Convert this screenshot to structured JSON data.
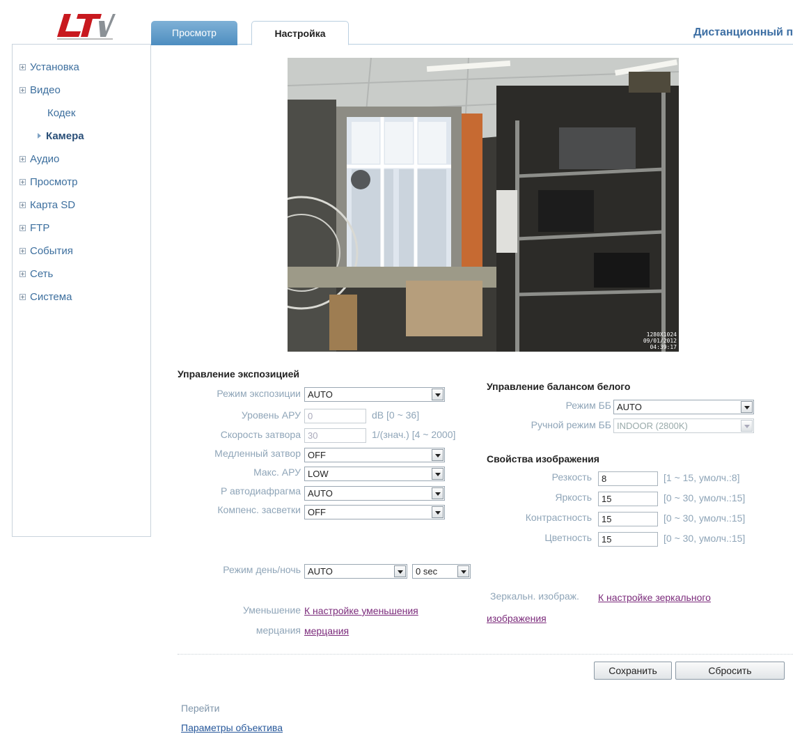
{
  "header": {
    "logo_text": "LTV",
    "tabs": [
      {
        "label": "Просмотр",
        "active": false
      },
      {
        "label": "Настройка",
        "active": true
      }
    ],
    "remote_title": "Дистанционный п"
  },
  "sidebar": {
    "items": [
      {
        "label": "Установка"
      },
      {
        "label": "Видео"
      },
      {
        "label": "Кодек"
      },
      {
        "label": "Камера"
      },
      {
        "label": "Аудио"
      },
      {
        "label": "Просмотр"
      },
      {
        "label": "Карта SD"
      },
      {
        "label": "FTP"
      },
      {
        "label": "События"
      },
      {
        "label": "Сеть"
      },
      {
        "label": "Система"
      }
    ]
  },
  "preview": {
    "osd_resolution": "1280X1024",
    "osd_date": "09/01/2012",
    "osd_time": "04:39:17"
  },
  "exposure": {
    "title": "Управление экспозицией",
    "mode": {
      "label": "Режим экспозиции",
      "value": "AUTO"
    },
    "agc_level": {
      "label": "Уровень АРУ",
      "value": "0",
      "hint": "dB [0 ~ 36]"
    },
    "shutter": {
      "label": "Скорость затвора",
      "value": "30",
      "hint": "1/(знач.) [4 ~ 2000]"
    },
    "slow_shutter": {
      "label": "Медленный затвор",
      "value": "OFF"
    },
    "max_agc": {
      "label": "Макс. АРУ",
      "value": "LOW"
    },
    "p_iris": {
      "label": "P автодиафрагма",
      "value": "AUTO"
    },
    "blc": {
      "label": "Компенс. засветки",
      "value": "OFF"
    }
  },
  "white_balance": {
    "title": "Управление балансом белого",
    "mode": {
      "label": "Режим ББ",
      "value": "AUTO"
    },
    "manual": {
      "label": "Ручной режим ББ",
      "value": "INDOOR (2800K)"
    }
  },
  "image_props": {
    "title": "Свойства изображения",
    "sharpness": {
      "label": "Резкость",
      "value": "8",
      "hint": "[1 ~ 15, умолч.:8]"
    },
    "brightness": {
      "label": "Яркость",
      "value": "15",
      "hint": "[0 ~ 30, умолч.:15]"
    },
    "contrast": {
      "label": "Контрастность",
      "value": "15",
      "hint": "[0 ~ 30, умолч.:15]"
    },
    "saturation": {
      "label": "Цветность",
      "value": "15",
      "hint": "[0 ~ 30, умолч.:15]"
    }
  },
  "day_night": {
    "label": "Режим день/ночь",
    "value": "AUTO",
    "delay": "0 sec"
  },
  "flicker": {
    "label_line1": "Уменьшение",
    "label_line2": "мерцания",
    "link_line1": "К настройке уменьшения",
    "link_line2": "мерцания"
  },
  "mirror": {
    "label": "Зеркальн. изображ.",
    "link_line1": "К настройке зеркального",
    "link_line2": "изображения"
  },
  "buttons": {
    "save": "Сохранить",
    "reset": "Сбросить"
  },
  "goto": {
    "label": "Перейти",
    "link": "Параметры объектива"
  }
}
